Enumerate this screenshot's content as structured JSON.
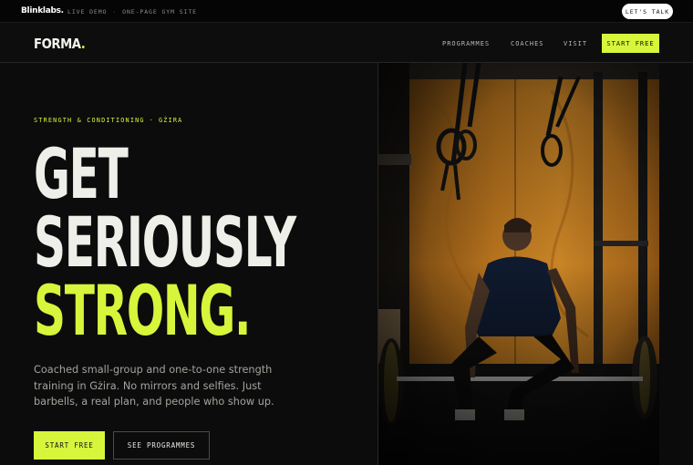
{
  "demo_bar": {
    "brand": "Blinklabs.",
    "tag_live": "LIVE DEMO",
    "tag_sep": "·",
    "tag_site": "ONE-PAGE GYM SITE",
    "cta": "LET'S TALK"
  },
  "nav": {
    "logo": "FORMA",
    "logo_dot": ".",
    "links": [
      "PROGRAMMES",
      "COACHES",
      "VISIT"
    ],
    "cta": "START FREE"
  },
  "hero": {
    "eyebrow_a": "STRENGTH & CONDITIONING",
    "eyebrow_sep": "·",
    "eyebrow_b": "GŻIRA",
    "headline": [
      "GET",
      "SERIOUSLY",
      "STRONG."
    ],
    "body": "Coached small-group and one-to-one strength training in Gżira. No mirrors and selfies. Just barbells, a real plan, and people who show up.",
    "primary_cta": "START FREE",
    "secondary_cta": "SEE PROGRAMMES"
  },
  "colors": {
    "accent": "#d7f53b",
    "background": "#0b0b0b",
    "text": "#efefe9"
  }
}
